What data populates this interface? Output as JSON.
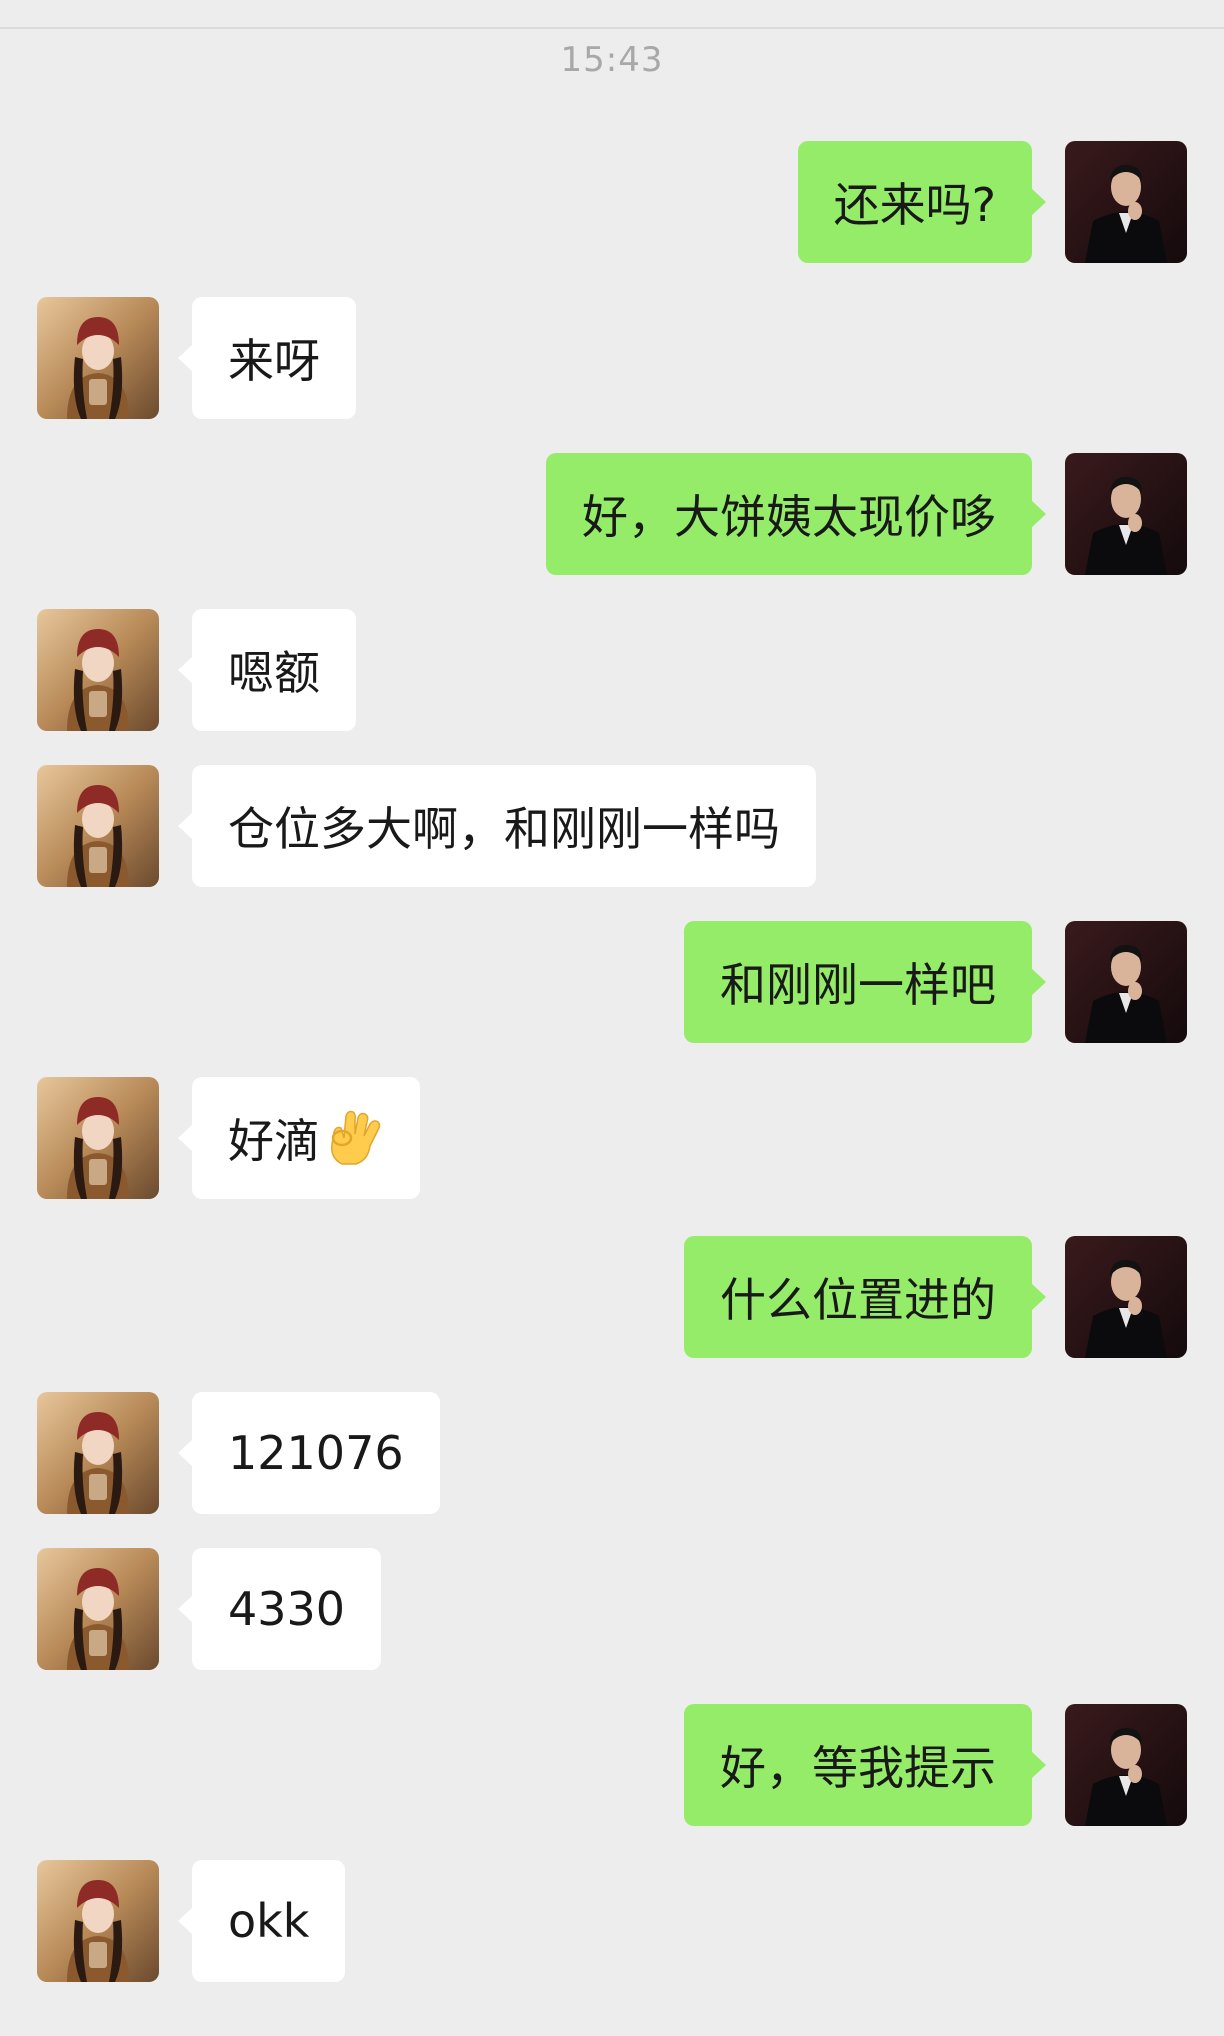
{
  "timestamp": "15:43",
  "messages": [
    {
      "from": "me",
      "text": "还来吗?"
    },
    {
      "from": "them",
      "text": "来呀"
    },
    {
      "from": "me",
      "text": "好，大饼姨太现价哆"
    },
    {
      "from": "them",
      "text": "嗯额"
    },
    {
      "from": "them",
      "text": "仓位多大啊，和刚刚一样吗"
    },
    {
      "from": "me",
      "text": "和刚刚一样吧"
    },
    {
      "from": "them",
      "text": "好滴",
      "emoji": "ok-hand-emoji"
    },
    {
      "from": "me",
      "text": "什么位置进的"
    },
    {
      "from": "them",
      "text": "121076"
    },
    {
      "from": "them",
      "text": "4330"
    },
    {
      "from": "me",
      "text": "好，等我提示"
    },
    {
      "from": "them",
      "text": "okk"
    }
  ],
  "colors": {
    "background": "#ededed",
    "sent_bubble": "#95ec69",
    "received_bubble": "#ffffff",
    "text": "#191919",
    "timestamp": "#a8a8a8"
  },
  "icons": {
    "my_avatar": "man-in-suit-avatar",
    "their_avatar": "girl-red-beanie-avatar",
    "emoji": "ok-hand-emoji"
  }
}
